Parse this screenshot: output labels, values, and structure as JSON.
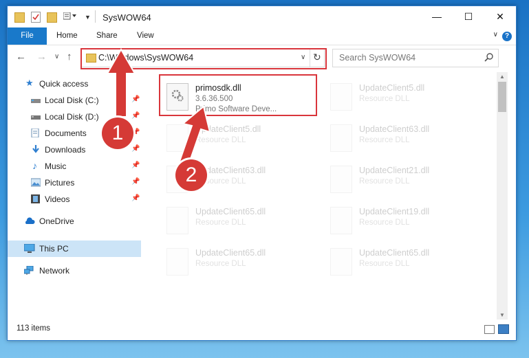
{
  "window": {
    "title": "SysWOW64"
  },
  "caption": {
    "minimize": "—",
    "maximize": "☐",
    "close": "✕"
  },
  "ribbon": {
    "tabs": [
      "File",
      "Home",
      "Share",
      "View"
    ],
    "help": "?"
  },
  "nav": {
    "back": "←",
    "forward": "→",
    "up": "↑",
    "recent": "∨"
  },
  "address": {
    "path": "C:\\Windows\\SysWOW64",
    "refresh": "↻"
  },
  "search": {
    "placeholder": "Search SysWOW64"
  },
  "sidebar": {
    "items": [
      {
        "label": "Quick access",
        "icon": "star-icon",
        "pinned": false
      },
      {
        "label": "Local Disk (C:)",
        "icon": "drive-icon",
        "pinned": true
      },
      {
        "label": "Local Disk (D:)",
        "icon": "drive-icon",
        "pinned": true
      },
      {
        "label": "Documents",
        "icon": "documents-icon",
        "pinned": true
      },
      {
        "label": "Downloads",
        "icon": "download-icon",
        "pinned": true
      },
      {
        "label": "Music",
        "icon": "music-icon",
        "pinned": true
      },
      {
        "label": "Pictures",
        "icon": "pictures-icon",
        "pinned": true
      },
      {
        "label": "Videos",
        "icon": "videos-icon",
        "pinned": true
      },
      {
        "label": "OneDrive",
        "icon": "cloud-icon",
        "pinned": false
      },
      {
        "label": "This PC",
        "icon": "computer-icon",
        "pinned": false,
        "selected": true
      },
      {
        "label": "Network",
        "icon": "network-icon",
        "pinned": false
      }
    ]
  },
  "files": [
    {
      "name": "primosdk.dll",
      "line1": "3.6.36.500",
      "line2": "Primo Software Deve...",
      "highlighted": true
    },
    {
      "name": "UpdateClient5.dll",
      "line1": "Resource DLL"
    },
    {
      "name": "UpdateClient5.dll",
      "line1": "Resource DLL"
    },
    {
      "name": "UpdateClient63.dll",
      "line1": "Resource DLL"
    },
    {
      "name": "UpdateClient63.dll",
      "line1": "Resource DLL"
    },
    {
      "name": "UpdateClient21.dll",
      "line1": "Resource DLL"
    },
    {
      "name": "UpdateClient65.dll",
      "line1": "Resource DLL"
    },
    {
      "name": "UpdateClient19.dll",
      "line1": "Resource DLL"
    },
    {
      "name": "UpdateClient65.dll",
      "line1": "Resource DLL"
    },
    {
      "name": "UpdateClient65.dll",
      "line1": "Resource DLL"
    }
  ],
  "status": {
    "item_count": "113 items"
  },
  "annotations": {
    "step1": "1",
    "step2": "2",
    "color": "#d53a36"
  }
}
